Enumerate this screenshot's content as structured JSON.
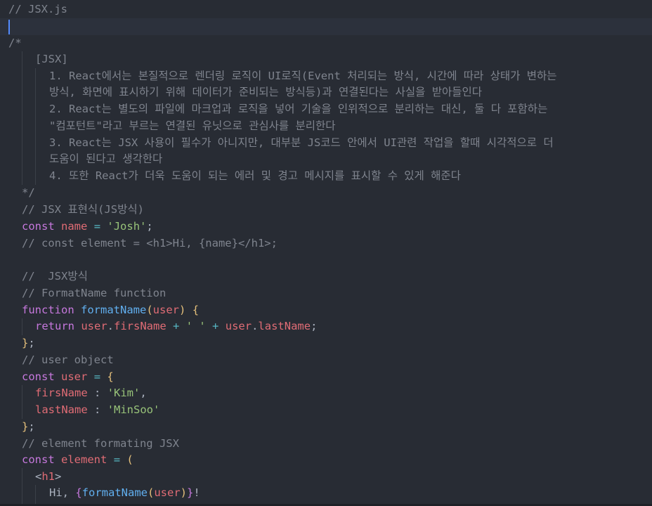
{
  "file_title_comment": "// JSX.js",
  "comment_block": {
    "open": "/*",
    "heading": "[JSX]",
    "items": [
      "1. React에서는 본질적으로 렌더링 로직이 UI로직(Event 처리되는 방식, 시간에 따라 상태가 변하는",
      "방식, 화면에 표시하기 위해 데이터가 준비되는 방식등)과 연결된다는 사실을 받아들인다",
      "2. React는 별도의 파일에 마크업과 로직을 넣어 기술을 인위적으로 분리하는 대신, 둘 다 포함하는",
      "\"컴포턴트\"라고 부르는 연결된 유닛으로 관심사를 분리한다",
      "3. React는 JSX 사용이 필수가 아니지만, 대부분 JS코드 안에서 UI관련 작업을 할때 시각적으로 더",
      "도움이 된다고 생각한다",
      "4. 또한 React가 더욱 도움이 되는 에러 및 경고 메시지를 표시할 수 있게 해준다"
    ],
    "close": "*/"
  },
  "code": {
    "c_jsx_expr": "// JSX 표현식(JS방식)",
    "kw_const": "const",
    "name_var": "name",
    "eq": "=",
    "josh_str": "'Josh'",
    "semicolon": ";",
    "c_const_element": "// const element = <h1>Hi, {name}</h1>;",
    "c_jsx_style": "//  JSX방식",
    "c_formatname_fn": "// FormatName function",
    "kw_function": "function",
    "fn_formatName": "formatName",
    "param_user": "user",
    "kw_return": "return",
    "prop_firsName": "firsName",
    "prop_lastName": "lastName",
    "plus": "+",
    "space_str": "' '",
    "c_user_object": "// user object",
    "kim_str": "'Kim'",
    "minsoo_str": "'MinSoo'",
    "c_element_formating": "// element formating JSX",
    "element_var": "element",
    "tag_h1": "h1",
    "hi_text": "Hi, ",
    "exclaim": "!"
  },
  "colors": {
    "background": "#282c34",
    "comment": "#7f848e",
    "keyword": "#c678dd",
    "variable": "#e06c75",
    "string": "#98c379",
    "function": "#61afef",
    "operator": "#56b6c2",
    "cursor": "#528bff"
  }
}
